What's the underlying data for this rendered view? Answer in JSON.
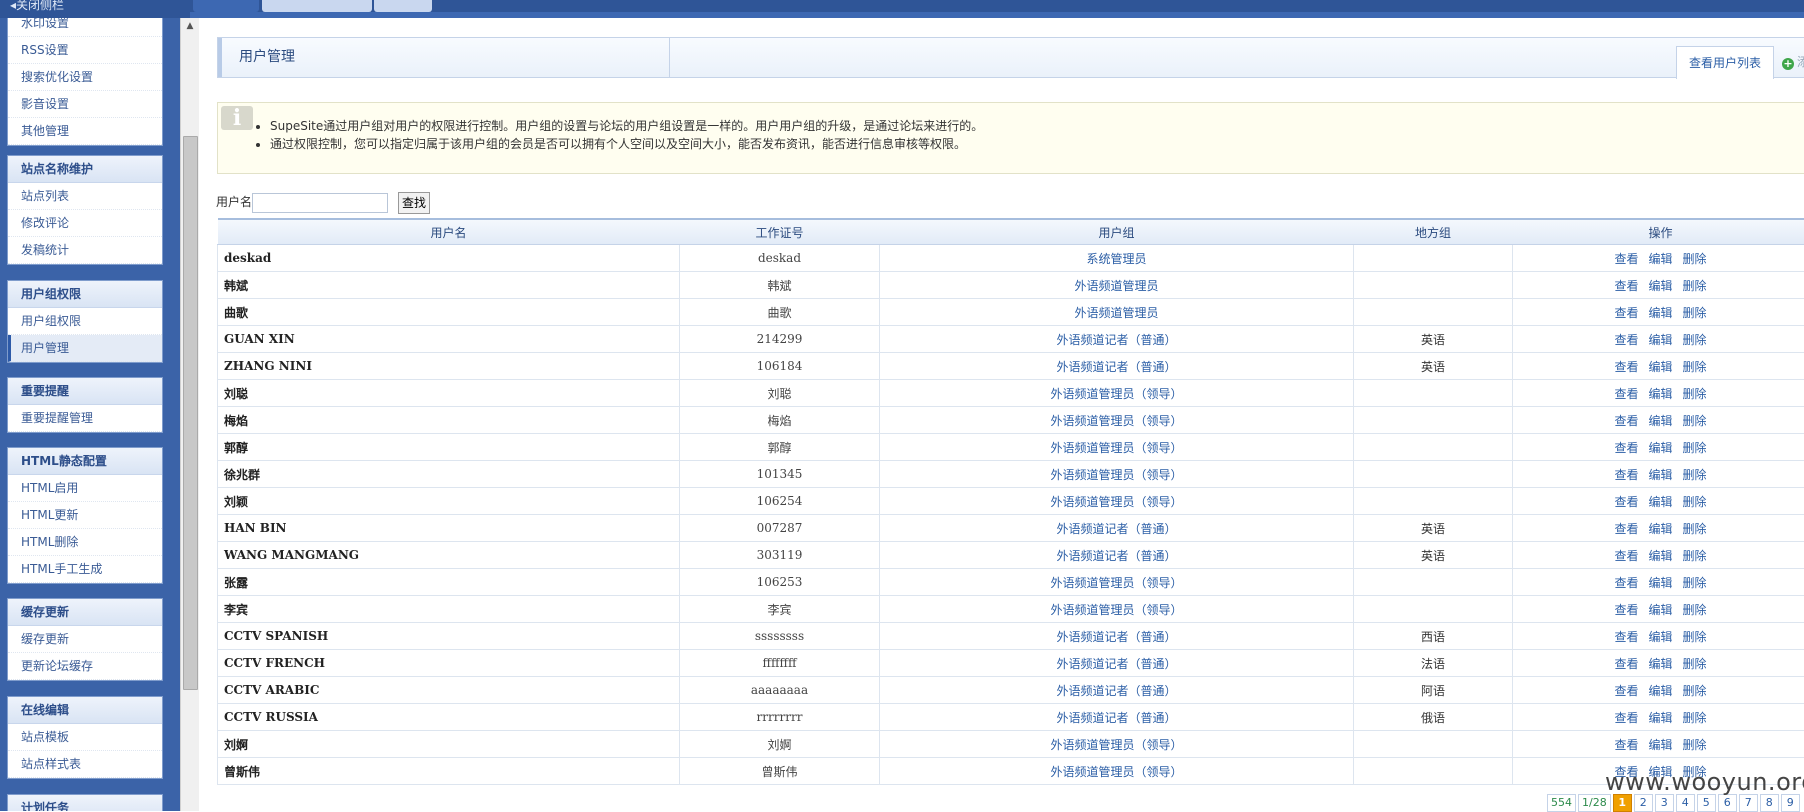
{
  "topbar": {
    "toggle": "◂关闭侧栏",
    "tabs": [
      "",
      "",
      ""
    ]
  },
  "sidebar": {
    "group0": {
      "items": [
        "水印设置",
        "RSS设置",
        "搜索优化设置",
        "影音设置",
        "其他管理"
      ]
    },
    "group1": {
      "title": "站点名称维护",
      "items": [
        "站点列表",
        "修改评论",
        "发稿统计"
      ]
    },
    "group2": {
      "title": "用户组权限",
      "items": [
        "用户组权限",
        "用户管理"
      ]
    },
    "group3": {
      "title": "重要提醒",
      "items": [
        "重要提醒管理"
      ]
    },
    "group4": {
      "title": "HTML静态配置",
      "items": [
        "HTML启用",
        "HTML更新",
        "HTML删除",
        "HTML手工生成"
      ]
    },
    "group5": {
      "title": "缓存更新",
      "items": [
        "缓存更新",
        "更新论坛缓存"
      ]
    },
    "group6": {
      "title": "在线编辑",
      "items": [
        "站点模板",
        "站点样式表"
      ]
    },
    "group7": {
      "title": "计划任务"
    }
  },
  "page": {
    "title": "用户管理",
    "tab_label": "查看用户列表",
    "add_label": "添"
  },
  "notice": {
    "line1": "SupeSite通过用户组对用户的权限进行控制。用户组的设置与论坛的用户组设置是一样的。用户用户组的升级，是通过论坛来进行的。",
    "line2": "通过权限控制，您可以指定归属于该用户组的会员是否可以拥有个人空间以及空间大小，能否发布资讯，能否进行信息审核等权限。"
  },
  "search": {
    "label": "用户名",
    "value": "",
    "button": "查找"
  },
  "table": {
    "headers": [
      "用户名",
      "工作证号",
      "用户组",
      "地方组",
      "操作"
    ],
    "ops": [
      "查看",
      "编辑",
      "删除"
    ],
    "rows": [
      {
        "name": "deskad",
        "code": "deskad",
        "group": "系统管理员",
        "region": ""
      },
      {
        "name": "韩斌",
        "code": "韩斌",
        "group": "外语频道管理员",
        "region": ""
      },
      {
        "name": "曲歌",
        "code": "曲歌",
        "group": "外语频道管理员",
        "region": ""
      },
      {
        "name": "GUAN XIN",
        "code": "214299",
        "group": "外语频道记者（普通）",
        "region": "英语"
      },
      {
        "name": "ZHANG NINI",
        "code": "106184",
        "group": "外语频道记者（普通）",
        "region": "英语"
      },
      {
        "name": "刘聪",
        "code": "刘聪",
        "group": "外语频道管理员（领导）",
        "region": ""
      },
      {
        "name": "梅焰",
        "code": "梅焰",
        "group": "外语频道管理员（领导）",
        "region": ""
      },
      {
        "name": "郭醇",
        "code": "郭醇",
        "group": "外语频道管理员（领导）",
        "region": ""
      },
      {
        "name": "徐兆群",
        "code": "101345",
        "group": "外语频道管理员（领导）",
        "region": ""
      },
      {
        "name": "刘颖",
        "code": "106254",
        "group": "外语频道管理员（领导）",
        "region": ""
      },
      {
        "name": "HAN BIN",
        "code": "007287",
        "group": "外语频道记者（普通）",
        "region": "英语"
      },
      {
        "name": "WANG MANGMANG",
        "code": "303119",
        "group": "外语频道记者（普通）",
        "region": "英语"
      },
      {
        "name": "张露",
        "code": "106253",
        "group": "外语频道管理员（领导）",
        "region": ""
      },
      {
        "name": "李宾",
        "code": "李宾",
        "group": "外语频道管理员（领导）",
        "region": ""
      },
      {
        "name": "CCTV SPANISH",
        "code": "ssssssss",
        "group": "外语频道记者（普通）",
        "region": "西语"
      },
      {
        "name": "CCTV FRENCH",
        "code": "ffffffff",
        "group": "外语频道记者（普通）",
        "region": "法语"
      },
      {
        "name": "CCTV ARABIC",
        "code": "aaaaaaaa",
        "group": "外语频道记者（普通）",
        "region": "阿语"
      },
      {
        "name": "CCTV RUSSIA",
        "code": "rrrrrrrr",
        "group": "外语频道记者（普通）",
        "region": "俄语"
      },
      {
        "name": "刘婀",
        "code": "刘婀",
        "group": "外语频道管理员（领导）",
        "region": ""
      },
      {
        "name": "曾斯伟",
        "code": "曾斯伟",
        "group": "外语频道管理员（领导）",
        "region": ""
      }
    ]
  },
  "pager": {
    "total": "554",
    "page_of": "1/28",
    "pages": [
      "1",
      "2",
      "3",
      "4",
      "5",
      "6",
      "7",
      "8",
      "9"
    ]
  },
  "watermark": "www.wooyun.org"
}
